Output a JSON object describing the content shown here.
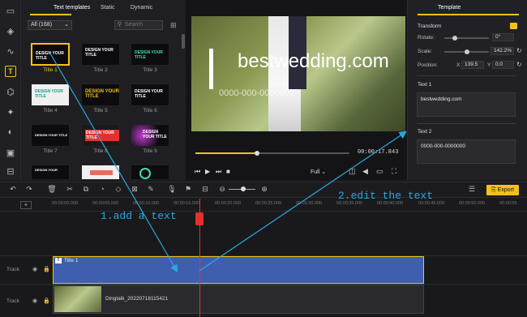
{
  "left_rail": {
    "icons": [
      "folder-icon",
      "layers-icon",
      "audio-wave-icon",
      "text-icon",
      "transition-icon",
      "effects-icon",
      "sticker-icon",
      "filter-icon",
      "split-icon"
    ]
  },
  "template_panel": {
    "tabs": [
      "Text templates",
      "Static",
      "Dynamic"
    ],
    "filter_value": "All (168)",
    "search_placeholder": "Search",
    "thumbnails": [
      {
        "label": "Title 1",
        "text": "DESIGN YOUR TITLE"
      },
      {
        "label": "Title 2",
        "text": "DESIGN YOUR TITLE"
      },
      {
        "label": "Title 3",
        "text": "DESIGN YOUR TITLE"
      },
      {
        "label": "Title 4",
        "text": "DESIGN YOUR TITLE"
      },
      {
        "label": "Title 5",
        "text": "DESIGN YOUR TITLE"
      },
      {
        "label": "Title 6",
        "text": "DESIGN YOUR TITLE"
      },
      {
        "label": "Title 7",
        "text": "DESIGN YOUR TITLE"
      },
      {
        "label": "Title 8",
        "text": "DESIGN YOUR TITLE"
      },
      {
        "label": "Title 9",
        "text": "DESIGN YOUR TITLE"
      },
      {
        "label": "",
        "text": "DESIGN YOUR"
      },
      {
        "label": "",
        "text": ""
      },
      {
        "label": "",
        "text": ""
      }
    ]
  },
  "preview": {
    "video_title": "bestwedding.com",
    "video_phone": "0000-000-0000000",
    "timecode": "00:00:17.843",
    "progress": 0.4,
    "quality": "Full"
  },
  "right_panel": {
    "tab": "Template",
    "transform_label": "Transform",
    "rotate_label": "Rotate:",
    "rotate_value": "0°",
    "scale_label": "Scale:",
    "scale_value": "142.2%",
    "position_label": "Position:",
    "pos_x_label": "X",
    "pos_x": "139.5",
    "pos_y_label": "Y",
    "pos_y": "0.0",
    "text1_label": "Text 1",
    "text1_value": "bestwedding.com",
    "text2_label": "Text 2",
    "text2_value": "0000-000-0000000"
  },
  "toolbar": {
    "export_label": "Export"
  },
  "timeline": {
    "ticks": [
      "00:00:00.000",
      "00:00:05.000",
      "00:00:10.000",
      "00:00:15.000",
      "00:00:20.000",
      "00:00:25.000",
      "00:00:30.000",
      "00:00:35.000",
      "00:00:40.000",
      "00:00:45.000",
      "00:00:50.000",
      "00:00:55"
    ],
    "track_label": "Track",
    "text_clip": "Title 1",
    "video_clip": "Dingtalk_20220718115421"
  },
  "annotations": {
    "add_text": "1.add a text",
    "edit_text": "2.edit the text"
  },
  "colors": {
    "accent": "#f2c21b",
    "annotation": "#29a8e0",
    "text_clip": "#3f5fae",
    "playhead": "#e0322d"
  }
}
